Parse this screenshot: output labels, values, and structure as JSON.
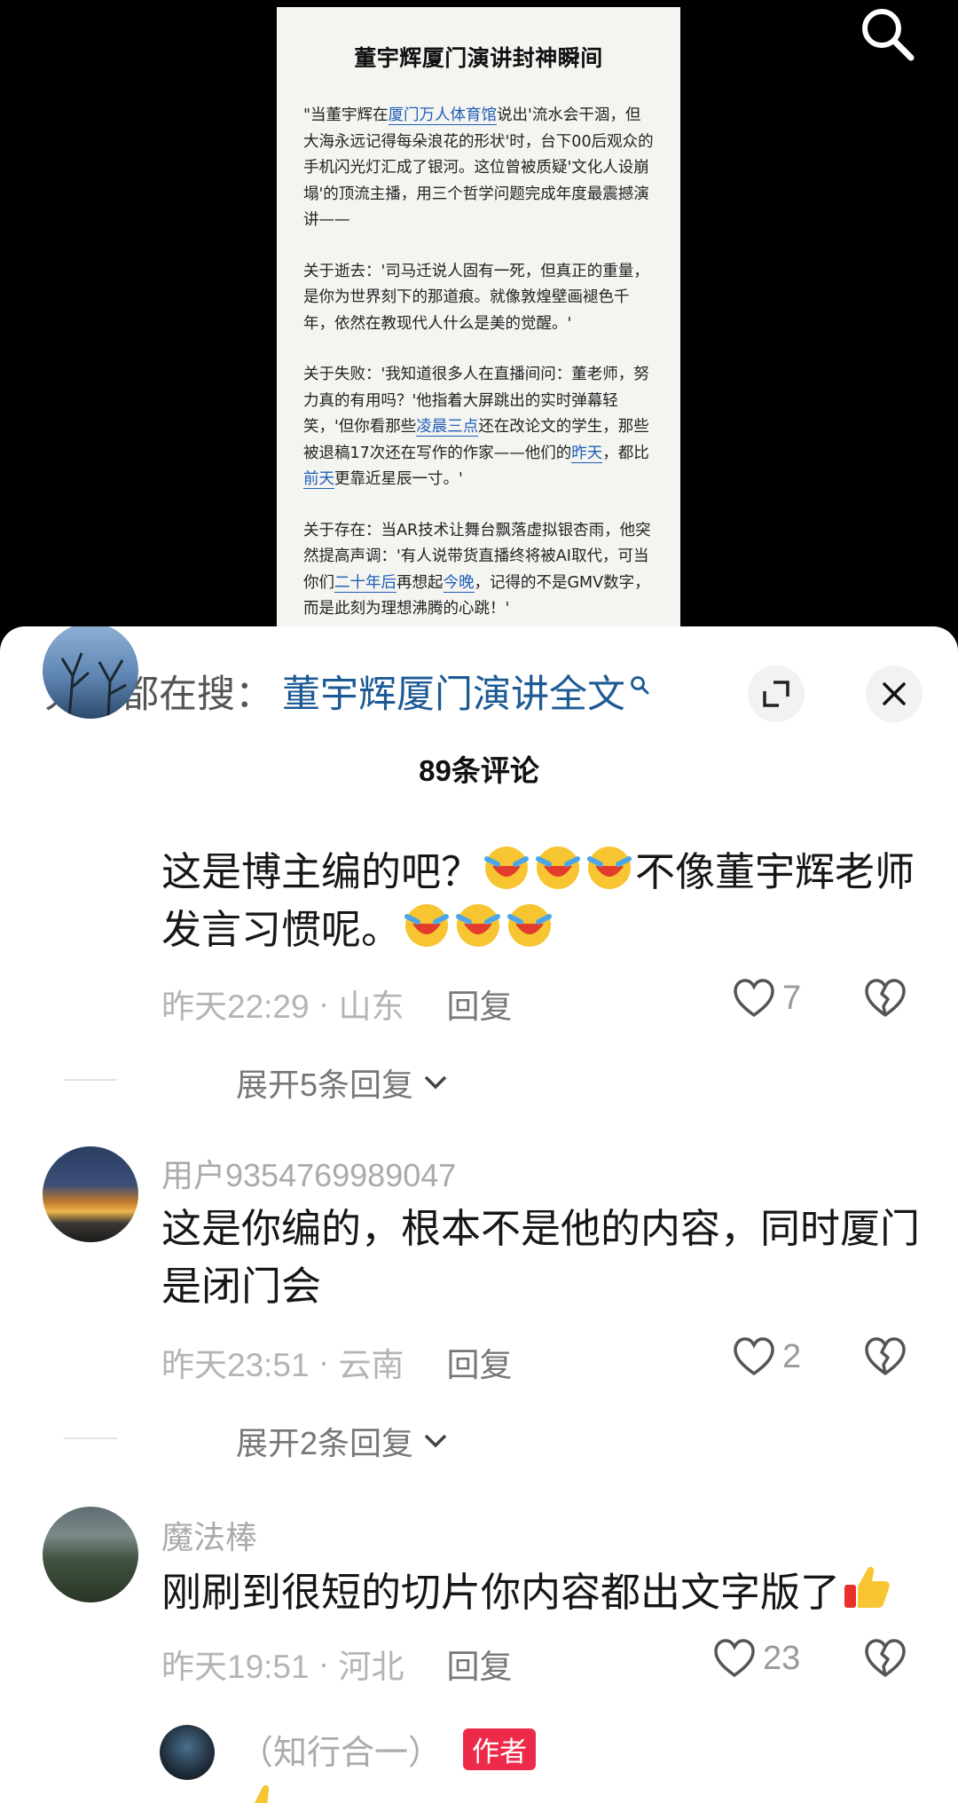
{
  "doc": {
    "title": "董宇辉厦门演讲封神瞬间",
    "p1": {
      "a": "\"当董宇辉在",
      "link": "厦门万人体育馆",
      "b": "说出'流水会干涸，但大海永远记得每朵浪花的形状'时，台下00后观众的手机闪光灯汇成了银河。这位曾被质疑'文化人设崩塌'的顶流主播，用三个哲学问题完成年度最震撼演讲——"
    },
    "p2": "关于逝去：'司马迁说人固有一死，但真正的重量，是你为世界刻下的那道痕。就像敦煌壁画褪色千年，依然在教现代人什么是美的觉醒。'",
    "p3": {
      "a": "关于失败：'我知道很多人在直播间问：董老师，努力真的有用吗？'他指着大屏跳出的实时弹幕轻笑，'但你看那些",
      "link1": "凌晨三点",
      "b": "还在改论文的学生，那些被退稿17次还在写作的作家——他们的",
      "link2": "昨天",
      "c": "，都比",
      "link3": "前天",
      "d": "更靠近星辰一寸。'"
    },
    "p4": {
      "a": "关于存在：当AR技术让舞台飘落虚拟银杏雨，他突然提高声调：'有人说带货直播终将被AI取代，可当你们",
      "link1": "二十年后",
      "b": "再想起",
      "link2": "今晚",
      "c": "，记得的不是GMV数字，而是此刻为理想沸腾的心跳！'"
    }
  },
  "panel": {
    "search_prefix": "大家都在搜：",
    "search_query": "董宇辉厦门演讲全文",
    "comment_count": "89条评论"
  },
  "comments": [
    {
      "username": "",
      "text_a": "这是博主编的吧？",
      "text_b": "不像董宇辉老师发言习惯呢。",
      "time": "昨天22:29",
      "location": "山东",
      "reply": "回复",
      "likes": "7",
      "expand": "展开5条回复"
    },
    {
      "username": "用户9354769989047",
      "text": "这是你编的，根本不是他的内容，同时厦门是闭门会",
      "time": "昨天23:51",
      "location": "云南",
      "reply": "回复",
      "likes": "2",
      "expand": "展开2条回复"
    },
    {
      "username": "魔法棒",
      "text": "刚刷到很短的切片你内容都出文字版了",
      "time": "昨天19:51",
      "location": "河北",
      "reply": "回复",
      "likes": "23"
    },
    {
      "username": "（知行合一）",
      "badge": "作者"
    }
  ],
  "separator": " · ",
  "colors": {
    "link": "#1f5fb8",
    "search_query": "#1d5a94",
    "author_badge": "#ee2a4b"
  }
}
